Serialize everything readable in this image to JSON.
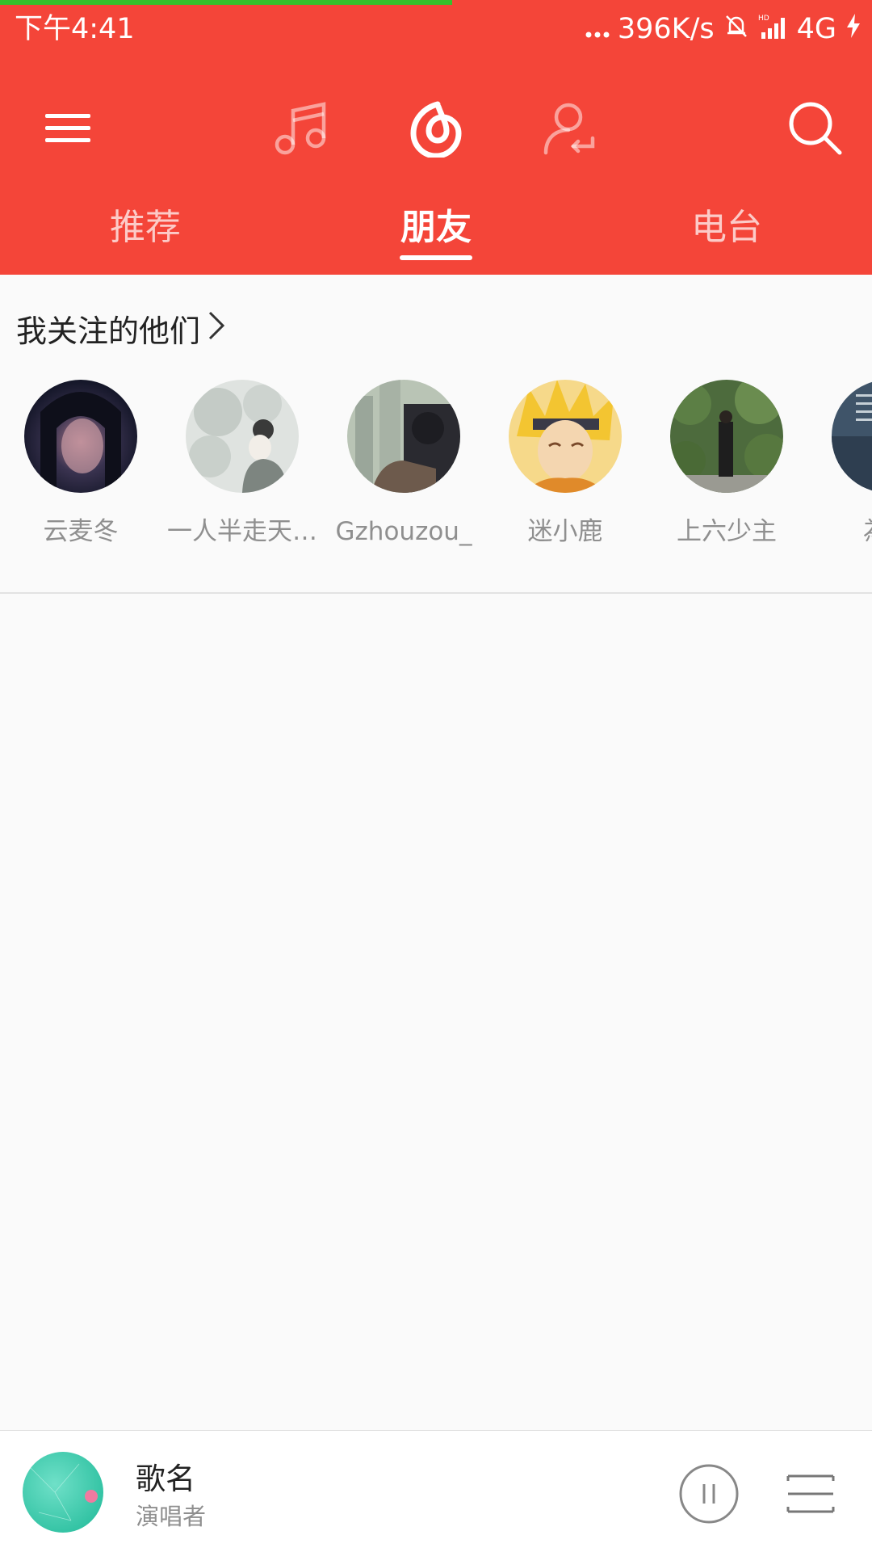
{
  "status_bar": {
    "time": "下午4:41",
    "net_speed": "396K/s",
    "network": "4G"
  },
  "toolbar": {
    "menu_icon": "hamburger-menu-icon",
    "music_icon": "music-note-icon",
    "netease_icon": "netease-cloud-music-logo-icon",
    "friends_icon": "user-refresh-icon",
    "search_icon": "search-icon"
  },
  "tabs": [
    {
      "label": "推荐",
      "active": false
    },
    {
      "label": "朋友",
      "active": true
    },
    {
      "label": "电台",
      "active": false
    }
  ],
  "follow_section": {
    "title": "我关注的他们",
    "friends": [
      {
        "name": "云麦冬"
      },
      {
        "name": "一人半走天…"
      },
      {
        "name": "Gzhouzou_"
      },
      {
        "name": "迷小鹿"
      },
      {
        "name": "上六少主"
      },
      {
        "name": "為誰"
      }
    ]
  },
  "player": {
    "song_title": "歌名",
    "artist": "演唱者"
  },
  "colors": {
    "brand_red": "#f44539",
    "loading_green": "#36c02b",
    "muted_text": "#8f8f8f"
  }
}
